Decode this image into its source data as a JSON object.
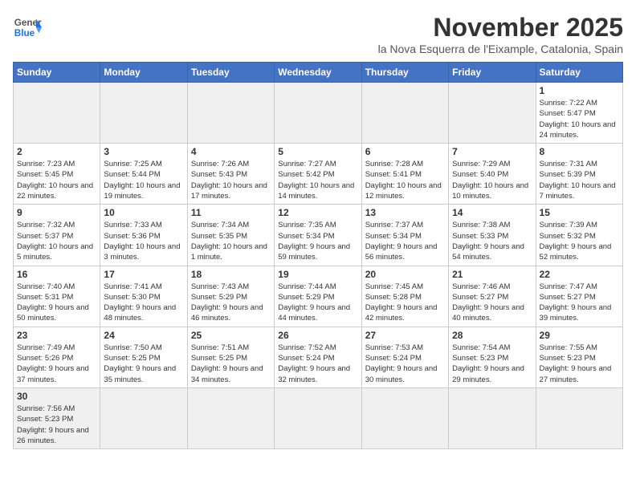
{
  "header": {
    "logo_line1": "General",
    "logo_line2": "Blue",
    "month_title": "November 2025",
    "location": "la Nova Esquerra de l'Eixample, Catalonia, Spain"
  },
  "days_of_week": [
    "Sunday",
    "Monday",
    "Tuesday",
    "Wednesday",
    "Thursday",
    "Friday",
    "Saturday"
  ],
  "weeks": [
    {
      "days": [
        {
          "num": "",
          "info": ""
        },
        {
          "num": "",
          "info": ""
        },
        {
          "num": "",
          "info": ""
        },
        {
          "num": "",
          "info": ""
        },
        {
          "num": "",
          "info": ""
        },
        {
          "num": "",
          "info": ""
        },
        {
          "num": "1",
          "info": "Sunrise: 7:22 AM\nSunset: 5:47 PM\nDaylight: 10 hours and 24 minutes."
        }
      ]
    },
    {
      "days": [
        {
          "num": "2",
          "info": "Sunrise: 7:23 AM\nSunset: 5:45 PM\nDaylight: 10 hours and 22 minutes."
        },
        {
          "num": "3",
          "info": "Sunrise: 7:25 AM\nSunset: 5:44 PM\nDaylight: 10 hours and 19 minutes."
        },
        {
          "num": "4",
          "info": "Sunrise: 7:26 AM\nSunset: 5:43 PM\nDaylight: 10 hours and 17 minutes."
        },
        {
          "num": "5",
          "info": "Sunrise: 7:27 AM\nSunset: 5:42 PM\nDaylight: 10 hours and 14 minutes."
        },
        {
          "num": "6",
          "info": "Sunrise: 7:28 AM\nSunset: 5:41 PM\nDaylight: 10 hours and 12 minutes."
        },
        {
          "num": "7",
          "info": "Sunrise: 7:29 AM\nSunset: 5:40 PM\nDaylight: 10 hours and 10 minutes."
        },
        {
          "num": "8",
          "info": "Sunrise: 7:31 AM\nSunset: 5:39 PM\nDaylight: 10 hours and 7 minutes."
        }
      ]
    },
    {
      "days": [
        {
          "num": "9",
          "info": "Sunrise: 7:32 AM\nSunset: 5:37 PM\nDaylight: 10 hours and 5 minutes."
        },
        {
          "num": "10",
          "info": "Sunrise: 7:33 AM\nSunset: 5:36 PM\nDaylight: 10 hours and 3 minutes."
        },
        {
          "num": "11",
          "info": "Sunrise: 7:34 AM\nSunset: 5:35 PM\nDaylight: 10 hours and 1 minute."
        },
        {
          "num": "12",
          "info": "Sunrise: 7:35 AM\nSunset: 5:34 PM\nDaylight: 9 hours and 59 minutes."
        },
        {
          "num": "13",
          "info": "Sunrise: 7:37 AM\nSunset: 5:34 PM\nDaylight: 9 hours and 56 minutes."
        },
        {
          "num": "14",
          "info": "Sunrise: 7:38 AM\nSunset: 5:33 PM\nDaylight: 9 hours and 54 minutes."
        },
        {
          "num": "15",
          "info": "Sunrise: 7:39 AM\nSunset: 5:32 PM\nDaylight: 9 hours and 52 minutes."
        }
      ]
    },
    {
      "days": [
        {
          "num": "16",
          "info": "Sunrise: 7:40 AM\nSunset: 5:31 PM\nDaylight: 9 hours and 50 minutes."
        },
        {
          "num": "17",
          "info": "Sunrise: 7:41 AM\nSunset: 5:30 PM\nDaylight: 9 hours and 48 minutes."
        },
        {
          "num": "18",
          "info": "Sunrise: 7:43 AM\nSunset: 5:29 PM\nDaylight: 9 hours and 46 minutes."
        },
        {
          "num": "19",
          "info": "Sunrise: 7:44 AM\nSunset: 5:29 PM\nDaylight: 9 hours and 44 minutes."
        },
        {
          "num": "20",
          "info": "Sunrise: 7:45 AM\nSunset: 5:28 PM\nDaylight: 9 hours and 42 minutes."
        },
        {
          "num": "21",
          "info": "Sunrise: 7:46 AM\nSunset: 5:27 PM\nDaylight: 9 hours and 40 minutes."
        },
        {
          "num": "22",
          "info": "Sunrise: 7:47 AM\nSunset: 5:27 PM\nDaylight: 9 hours and 39 minutes."
        }
      ]
    },
    {
      "days": [
        {
          "num": "23",
          "info": "Sunrise: 7:49 AM\nSunset: 5:26 PM\nDaylight: 9 hours and 37 minutes."
        },
        {
          "num": "24",
          "info": "Sunrise: 7:50 AM\nSunset: 5:25 PM\nDaylight: 9 hours and 35 minutes."
        },
        {
          "num": "25",
          "info": "Sunrise: 7:51 AM\nSunset: 5:25 PM\nDaylight: 9 hours and 34 minutes."
        },
        {
          "num": "26",
          "info": "Sunrise: 7:52 AM\nSunset: 5:24 PM\nDaylight: 9 hours and 32 minutes."
        },
        {
          "num": "27",
          "info": "Sunrise: 7:53 AM\nSunset: 5:24 PM\nDaylight: 9 hours and 30 minutes."
        },
        {
          "num": "28",
          "info": "Sunrise: 7:54 AM\nSunset: 5:23 PM\nDaylight: 9 hours and 29 minutes."
        },
        {
          "num": "29",
          "info": "Sunrise: 7:55 AM\nSunset: 5:23 PM\nDaylight: 9 hours and 27 minutes."
        }
      ]
    },
    {
      "days": [
        {
          "num": "30",
          "info": "Sunrise: 7:56 AM\nSunset: 5:23 PM\nDaylight: 9 hours and 26 minutes."
        },
        {
          "num": "",
          "info": ""
        },
        {
          "num": "",
          "info": ""
        },
        {
          "num": "",
          "info": ""
        },
        {
          "num": "",
          "info": ""
        },
        {
          "num": "",
          "info": ""
        },
        {
          "num": "",
          "info": ""
        }
      ]
    }
  ]
}
